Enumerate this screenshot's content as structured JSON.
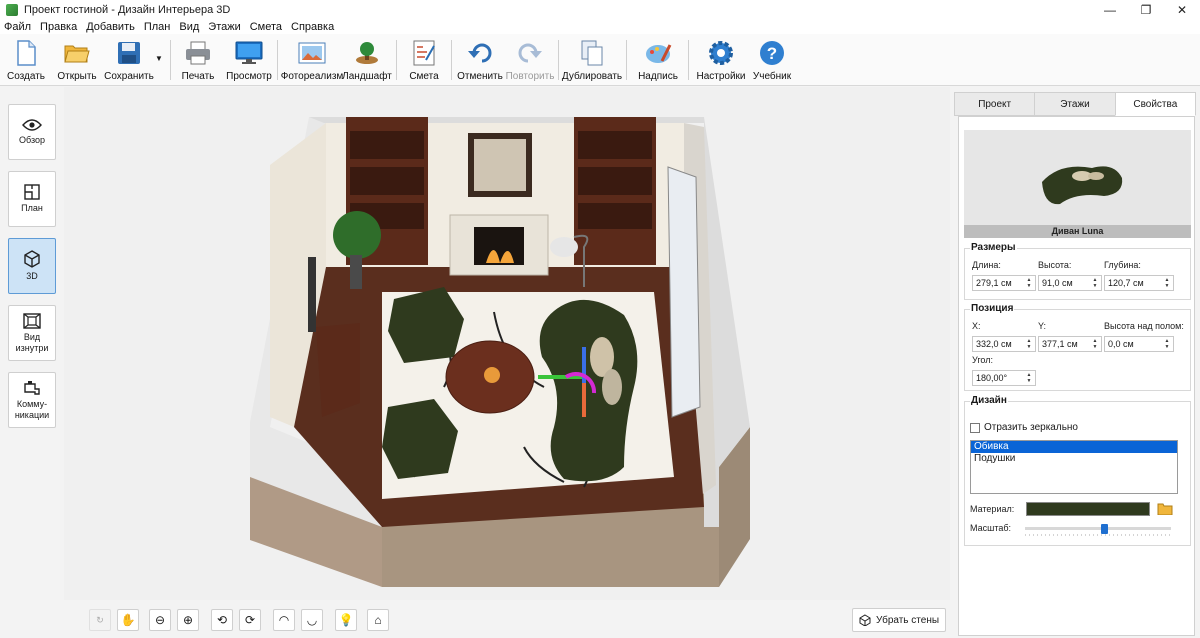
{
  "window": {
    "title": "Проект гостиной - Дизайн Интерьера 3D",
    "minimize": "—",
    "maximize": "❐",
    "close": "✕"
  },
  "menu": [
    "Файл",
    "Правка",
    "Добавить",
    "План",
    "Вид",
    "Этажи",
    "Смета",
    "Справка"
  ],
  "toolbar": {
    "create": "Создать",
    "open": "Открыть",
    "save": "Сохранить",
    "print": "Печать",
    "preview": "Просмотр",
    "photorealism": "Фотореализм",
    "landscape": "Ландшафт",
    "estimate": "Смета",
    "undo": "Отменить",
    "redo": "Повторить",
    "duplicate": "Дублировать",
    "caption": "Надпись",
    "settings": "Настройки",
    "tutorial": "Учебник"
  },
  "left_panel": {
    "overview": "Обзор",
    "plan": "План",
    "view3d": "3D",
    "inside_view": "Вид изнутри",
    "utilities": "Комму-никации"
  },
  "bottom": {
    "remove_walls": "Убрать стены"
  },
  "right_panel": {
    "tabs": [
      "Проект",
      "Этажи",
      "Свойства"
    ],
    "active_tab": "Свойства",
    "object_name": "Диван Luna",
    "sizes": {
      "title": "Размеры",
      "length_label": "Длина:",
      "length": "279,1 см",
      "height_label": "Высота:",
      "height": "91,0 см",
      "depth_label": "Глубина:",
      "depth": "120,7 см"
    },
    "position": {
      "title": "Позиция",
      "x_label": "X:",
      "x": "332,0 см",
      "y_label": "Y:",
      "y": "377,1 см",
      "elev_label": "Высота над полом:",
      "elev": "0,0 см",
      "angle_label": "Угол:",
      "angle": "180,00°"
    },
    "design": {
      "title": "Дизайн",
      "mirror_label": "Отразить зеркально",
      "mirror_checked": false,
      "parts": [
        "Обивка",
        "Подушки"
      ],
      "selected_part": "Обивка",
      "material_label": "Материал:",
      "material_color": "#2f3a1e",
      "scale_label": "Масштаб:"
    }
  }
}
